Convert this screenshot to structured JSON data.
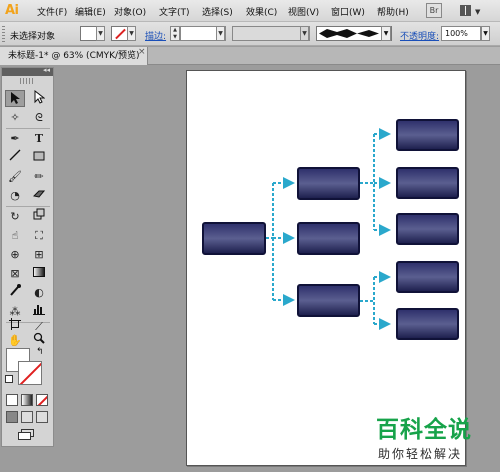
{
  "app": {
    "logo": "Ai"
  },
  "menu": {
    "items": [
      "文件(F)",
      "编辑(E)",
      "对象(O)",
      "文字(T)",
      "选择(S)",
      "效果(C)",
      "视图(V)",
      "窗口(W)",
      "帮助(H)"
    ],
    "bridge_label": "Br"
  },
  "control_bar": {
    "selection_status": "未选择对象",
    "stroke_label": "描边:",
    "opacity_label": "不透明度:",
    "opacity_value": "100%"
  },
  "document": {
    "tab_title": "未标题-1* @ 63% (CMYK/预览)",
    "close_glyph": "×"
  },
  "tools": {
    "icons": [
      "selection-tool-icon",
      "direct-selection-tool-icon",
      "magic-wand-tool-icon",
      "lasso-tool-icon",
      "pen-tool-icon",
      "type-tool-icon",
      "line-tool-icon",
      "rectangle-tool-icon",
      "paintbrush-tool-icon",
      "pencil-tool-icon",
      "blob-brush-tool-icon",
      "eraser-tool-icon",
      "rotate-tool-icon",
      "scale-tool-icon",
      "warp-tool-icon",
      "free-transform-tool-icon",
      "shape-builder-tool-icon",
      "perspective-grid-tool-icon",
      "mesh-tool-icon",
      "gradient-tool-icon",
      "eyedropper-tool-icon",
      "blend-tool-icon",
      "symbol-sprayer-tool-icon",
      "column-graph-tool-icon",
      "artboard-tool-icon",
      "slice-tool-icon",
      "hand-tool-icon",
      "zoom-tool-icon"
    ]
  },
  "colors": {
    "app_bg": "#9c9c9c",
    "node_fill_dark": "#1d1f4e",
    "node_fill_mid": "#4e5280",
    "connector": "#2aa8cc",
    "watermark_green": "#17a34a"
  },
  "watermark": {
    "title": "百科全说",
    "subtitle": "助你轻松解决"
  }
}
